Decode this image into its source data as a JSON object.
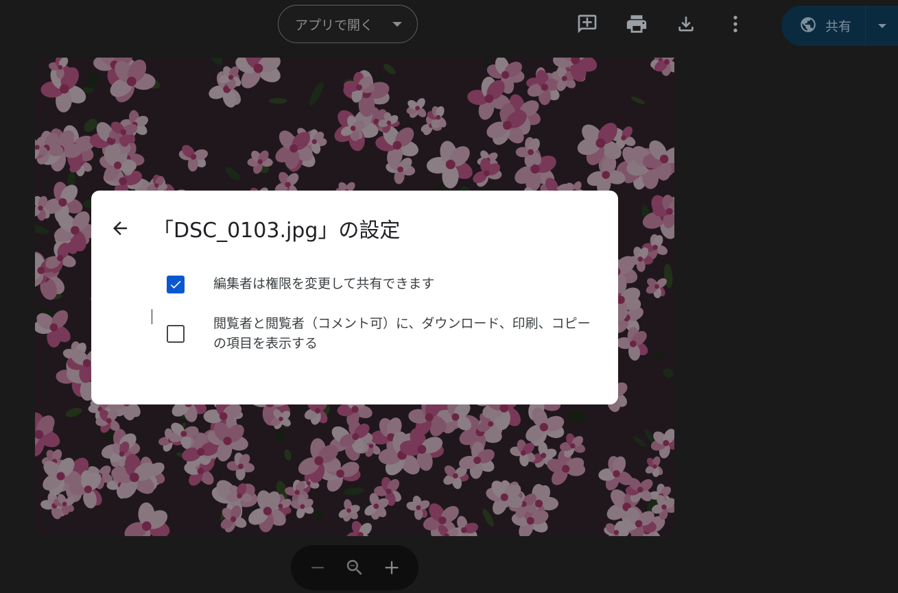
{
  "toolbar": {
    "open_with_label": "アプリで開く",
    "icons": [
      "add-comment-icon",
      "print-icon",
      "download-icon",
      "more-vert-icon"
    ],
    "share_label": "共有",
    "share_icon": "globe-icon",
    "share_bg": "#0a2a3f"
  },
  "image": {
    "subject": "pink-azalea-photo"
  },
  "dialog": {
    "title": "「DSC_0103.jpg」の設定",
    "options": [
      {
        "label": "編集者は権限を変更して共有できます",
        "checked": true
      },
      {
        "label": "閲覧者と閲覧者（コメント可）に、ダウンロード、印刷、コピーの項目を表示する",
        "checked": false
      }
    ],
    "accent": "#0b57d0"
  },
  "zoom_bar": {
    "icons": [
      "zoom-out-icon",
      "zoom-reset-icon",
      "zoom-in-icon"
    ]
  }
}
